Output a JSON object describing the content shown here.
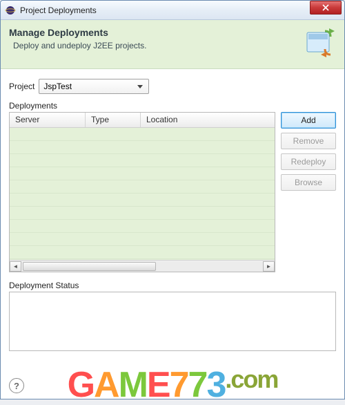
{
  "window": {
    "title": "Project Deployments"
  },
  "header": {
    "title": "Manage Deployments",
    "subtitle": "Deploy and undeploy J2EE projects."
  },
  "project": {
    "label": "Project",
    "selected": "JspTest"
  },
  "deployments": {
    "label": "Deployments",
    "columns": {
      "server": "Server",
      "type": "Type",
      "location": "Location"
    },
    "rows": []
  },
  "buttons": {
    "add": "Add",
    "remove": "Remove",
    "redeploy": "Redeploy",
    "browse": "Browse"
  },
  "status": {
    "label": "Deployment Status",
    "text": ""
  },
  "footer": {
    "help": "?"
  },
  "watermark": {
    "text": "GAME773.com"
  }
}
